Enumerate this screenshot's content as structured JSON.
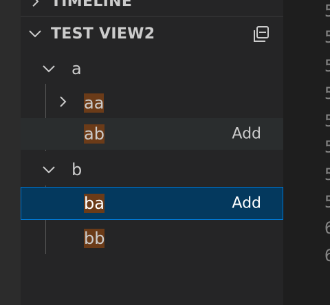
{
  "sections": {
    "timeline": {
      "title": "TIMELINE"
    },
    "test_view2": {
      "title": "TEST VIEW2"
    }
  },
  "tree": {
    "a": {
      "label": "a"
    },
    "aa": {
      "label": "aa"
    },
    "ab": {
      "label": "ab",
      "action": "Add"
    },
    "b": {
      "label": "b"
    },
    "ba": {
      "label": "ba",
      "action": "Add"
    },
    "bb": {
      "label": "bb"
    }
  },
  "icons": {
    "collapse_all": "collapse-all-icon",
    "chevron_down": "chevron-down-icon",
    "chevron_right": "chevron-right-icon"
  },
  "editor": {
    "line_numbers": [
      "5",
      "5",
      "5",
      "5",
      "5",
      "5",
      "5",
      "5",
      "6",
      "6"
    ]
  },
  "colors": {
    "highlight": "#6b3b18",
    "selection_bg": "#04395e",
    "selection_border": "#0078d4",
    "sidebar_bg": "#252526"
  }
}
